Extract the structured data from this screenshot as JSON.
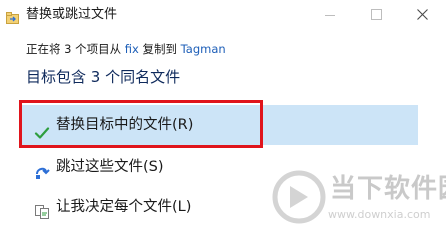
{
  "window": {
    "title": "替换或跳过文件"
  },
  "copy_info": {
    "prefix": "正在将 3 个项目从 ",
    "source": "fix",
    "middle": " 复制到 ",
    "destination": "Tagman"
  },
  "heading": "目标包含 3 个同名文件",
  "options": {
    "replace": {
      "label": "替换目标中的文件(R)",
      "icon": "checkmark-icon",
      "selected": true
    },
    "skip": {
      "label": "跳过这些文件(S)",
      "icon": "skip-arrow-icon"
    },
    "decide": {
      "label": "让我决定每个文件(L)",
      "icon": "compare-files-icon"
    }
  },
  "watermark": {
    "title": "当下软件园",
    "url": "www.downxia.com"
  },
  "colors": {
    "accent_text": "#1e5fb8",
    "selected_background": "#cce4f7",
    "highlight_border": "#e0141c",
    "checkmark": "#2e9e3e"
  }
}
